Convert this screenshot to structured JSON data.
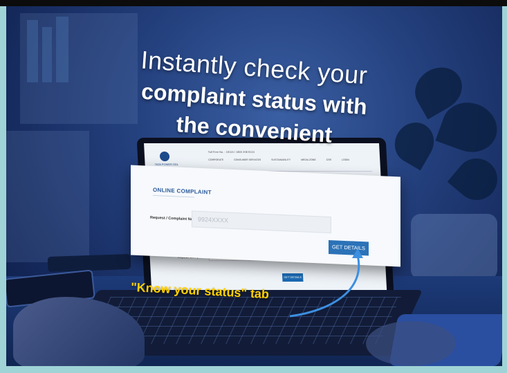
{
  "headline": {
    "line1": "Instantly check your",
    "line2": "complaint status with",
    "line3": "the convenient"
  },
  "screen": {
    "logo_text": "TATA POWER DDL",
    "toll_free": "Toll Free No. : 19124 / 1800 208 9124",
    "nav": [
      "CORPORATE",
      "CONSUMER SERVICES",
      "SUSTAINABILITY",
      "MEDIA ZONE",
      "CSR",
      "LOGIN"
    ],
    "repeat_label": "Repeat Complaints",
    "button2": "GET DETAILS"
  },
  "card": {
    "title": "ONLINE COMPLAINT",
    "field_label": "Request / Complaint No",
    "field_value": "9924XXXX",
    "button": "GET DETAILS"
  },
  "callout": {
    "text": "\"Know your status\" tab",
    "color": "#ffd000"
  },
  "colors": {
    "background": "#1c3a7a",
    "button": "#2b72b8",
    "border": "#9fd3d6"
  }
}
